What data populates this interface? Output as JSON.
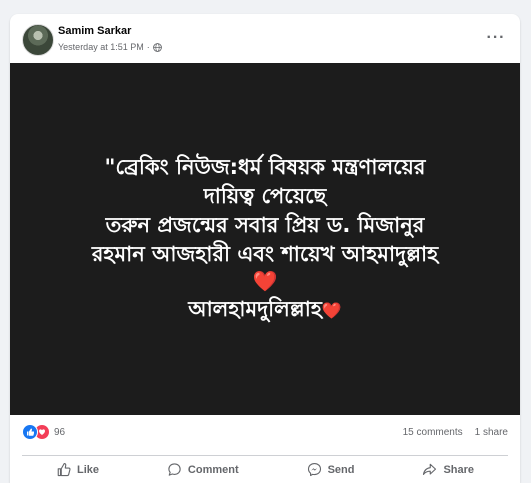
{
  "post": {
    "author": "Samim Sarkar",
    "timestamp": "Yesterday at 1:51 PM",
    "separator": "·",
    "privacy_icon": "globe-icon",
    "more_icon": "more-options-icon",
    "more_label": "···"
  },
  "media": {
    "lines": [
      "\"ব্রেকিং নিউজ:ধর্ম বিষয়ক মন্ত্রণালয়ের",
      "দায়িত্ব পেয়েছে",
      "তরুন প্রজন্মের সবার প্রিয় ড. মিজানুর",
      "রহমান আজহারী এবং শায়েখ আহমাদুল্লাহ"
    ],
    "heart": "❤️",
    "closing_line": "আলহামদুলিল্লাহ",
    "closing_heart": "❤️",
    "background": "#1c1c1c",
    "text_color": "#ffffff"
  },
  "stats": {
    "reaction_icons": [
      "like-icon",
      "love-icon"
    ],
    "reaction_count": "96",
    "comments": "15 comments",
    "shares": "1 share"
  },
  "actions": [
    {
      "label": "Like",
      "icon": "thumbs-up-icon"
    },
    {
      "label": "Comment",
      "icon": "comment-bubble-icon"
    },
    {
      "label": "Send",
      "icon": "messenger-icon"
    },
    {
      "label": "Share",
      "icon": "share-arrow-icon"
    }
  ],
  "colors": {
    "page_background": "#f0f2f5",
    "card_background": "#ffffff",
    "secondary_text": "#65676b",
    "like_blue": "#1877f2",
    "love_red": "#f33e58"
  }
}
